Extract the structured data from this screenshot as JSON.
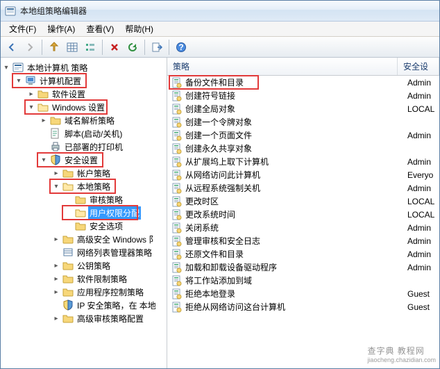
{
  "window": {
    "title": "本地组策略编辑器"
  },
  "menu": {
    "file": "文件(F)",
    "action": "操作(A)",
    "view": "查看(V)",
    "help": "帮助(H)"
  },
  "toolbar_icons": [
    "back",
    "forward",
    "up",
    "table",
    "list",
    "delete",
    "refresh",
    "export",
    "help"
  ],
  "tree": {
    "root": "本地计算机 策略",
    "computer_cfg": "计算机配置",
    "software": "软件设置",
    "windows_settings": "Windows 设置",
    "dns_policy": "域名解析策略",
    "scripts": "脚本(启动/关机)",
    "printers": "已部署的打印机",
    "security_settings": "安全设置",
    "account_policy": "帐户策略",
    "local_policy": "本地策略",
    "audit_policy": "审核策略",
    "user_rights": "用户权限分配",
    "security_options": "安全选项",
    "adv_security": "高级安全 Windows 阝",
    "netlist_mgr": "网络列表管理器策略",
    "pubkey_policy": "公钥策略",
    "software_restrict": "软件限制策略",
    "app_control": "应用程序控制策略",
    "ip_security": "IP 安全策略，在 本地",
    "adv_audit": "高级审核策略配置"
  },
  "list": {
    "col_policy": "策略",
    "col_security": "安全设",
    "rows": [
      {
        "name": "备份文件和目录",
        "sec": "Admin",
        "hl": true
      },
      {
        "name": "创建符号链接",
        "sec": "Admin"
      },
      {
        "name": "创建全局对象",
        "sec": "LOCAL"
      },
      {
        "name": "创建一个令牌对象",
        "sec": ""
      },
      {
        "name": "创建一个页面文件",
        "sec": "Admin"
      },
      {
        "name": "创建永久共享对象",
        "sec": ""
      },
      {
        "name": "从扩展坞上取下计算机",
        "sec": "Admin"
      },
      {
        "name": "从网络访问此计算机",
        "sec": "Everyo"
      },
      {
        "name": "从远程系统强制关机",
        "sec": "Admin"
      },
      {
        "name": "更改时区",
        "sec": "LOCAL"
      },
      {
        "name": "更改系统时间",
        "sec": "LOCAL"
      },
      {
        "name": "关闭系统",
        "sec": "Admin"
      },
      {
        "name": "管理审核和安全日志",
        "sec": "Admin"
      },
      {
        "name": "还原文件和目录",
        "sec": "Admin"
      },
      {
        "name": "加载和卸载设备驱动程序",
        "sec": "Admin"
      },
      {
        "name": "将工作站添加到域",
        "sec": ""
      },
      {
        "name": "拒绝本地登录",
        "sec": "Guest"
      },
      {
        "name": "拒绝从网络访问这台计算机",
        "sec": "Guest"
      }
    ]
  },
  "watermark": {
    "main": "查字典 教程网",
    "sub": "jiaocheng.chazidian.com"
  }
}
